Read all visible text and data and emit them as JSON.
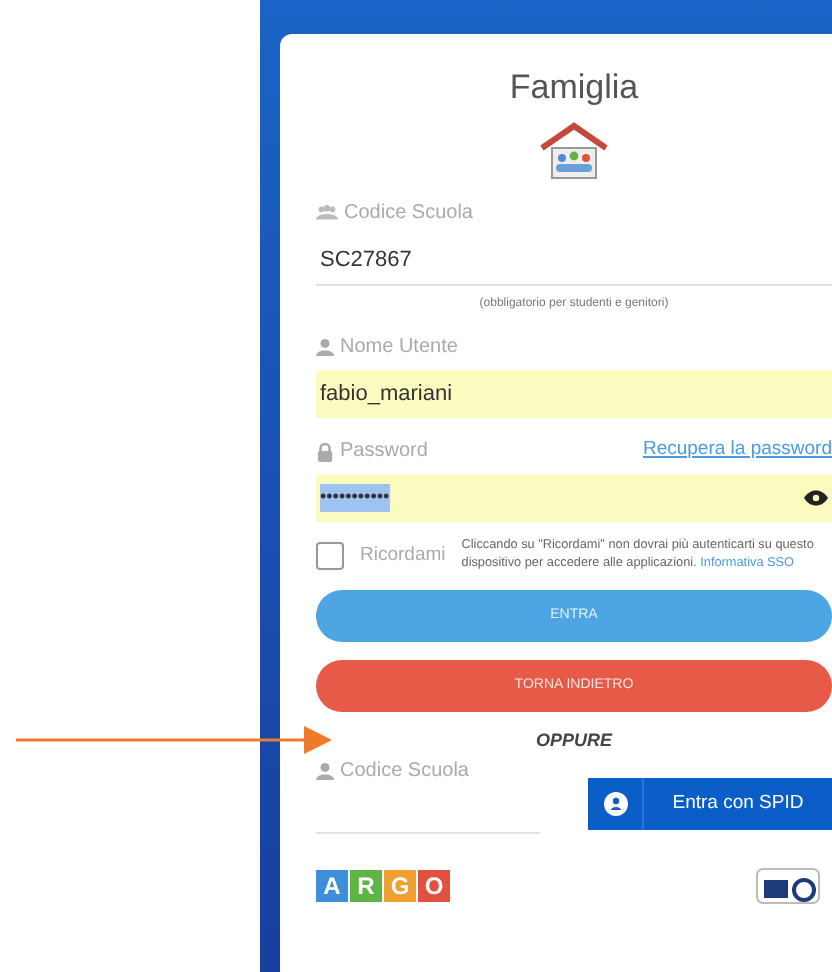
{
  "title": "Famiglia",
  "school_code": {
    "label": "Codice Scuola",
    "value": "SC27867",
    "hint": "(obbligatorio per studenti e genitori)"
  },
  "username": {
    "label": "Nome Utente",
    "value": "fabio_mariani"
  },
  "password": {
    "label": "Password",
    "value": "•••••••••••",
    "text_selected": true,
    "recover_link": "Recupera la password"
  },
  "remember": {
    "label": "Ricordami",
    "checked": false,
    "note": "Cliccando su \"Ricordami\" non dovrai più autenticarti su questo dispositivo per accedere alle applicazioni.",
    "link": "Informativa SSO"
  },
  "buttons": [
    {
      "label": "ENTRA",
      "kind": "primary"
    },
    {
      "label": "TORNA INDIETRO",
      "kind": "danger"
    }
  ],
  "separator": "OPPURE",
  "spid": {
    "label": "Codice Scuola",
    "button": "Entra con SPID"
  },
  "logo": {
    "letters": [
      {
        "text": "A",
        "color": "#3d8fd9"
      },
      {
        "text": "R",
        "color": "#5fb446"
      },
      {
        "text": "G",
        "color": "#f0a030"
      },
      {
        "text": "O",
        "color": "#e2513f"
      }
    ]
  }
}
